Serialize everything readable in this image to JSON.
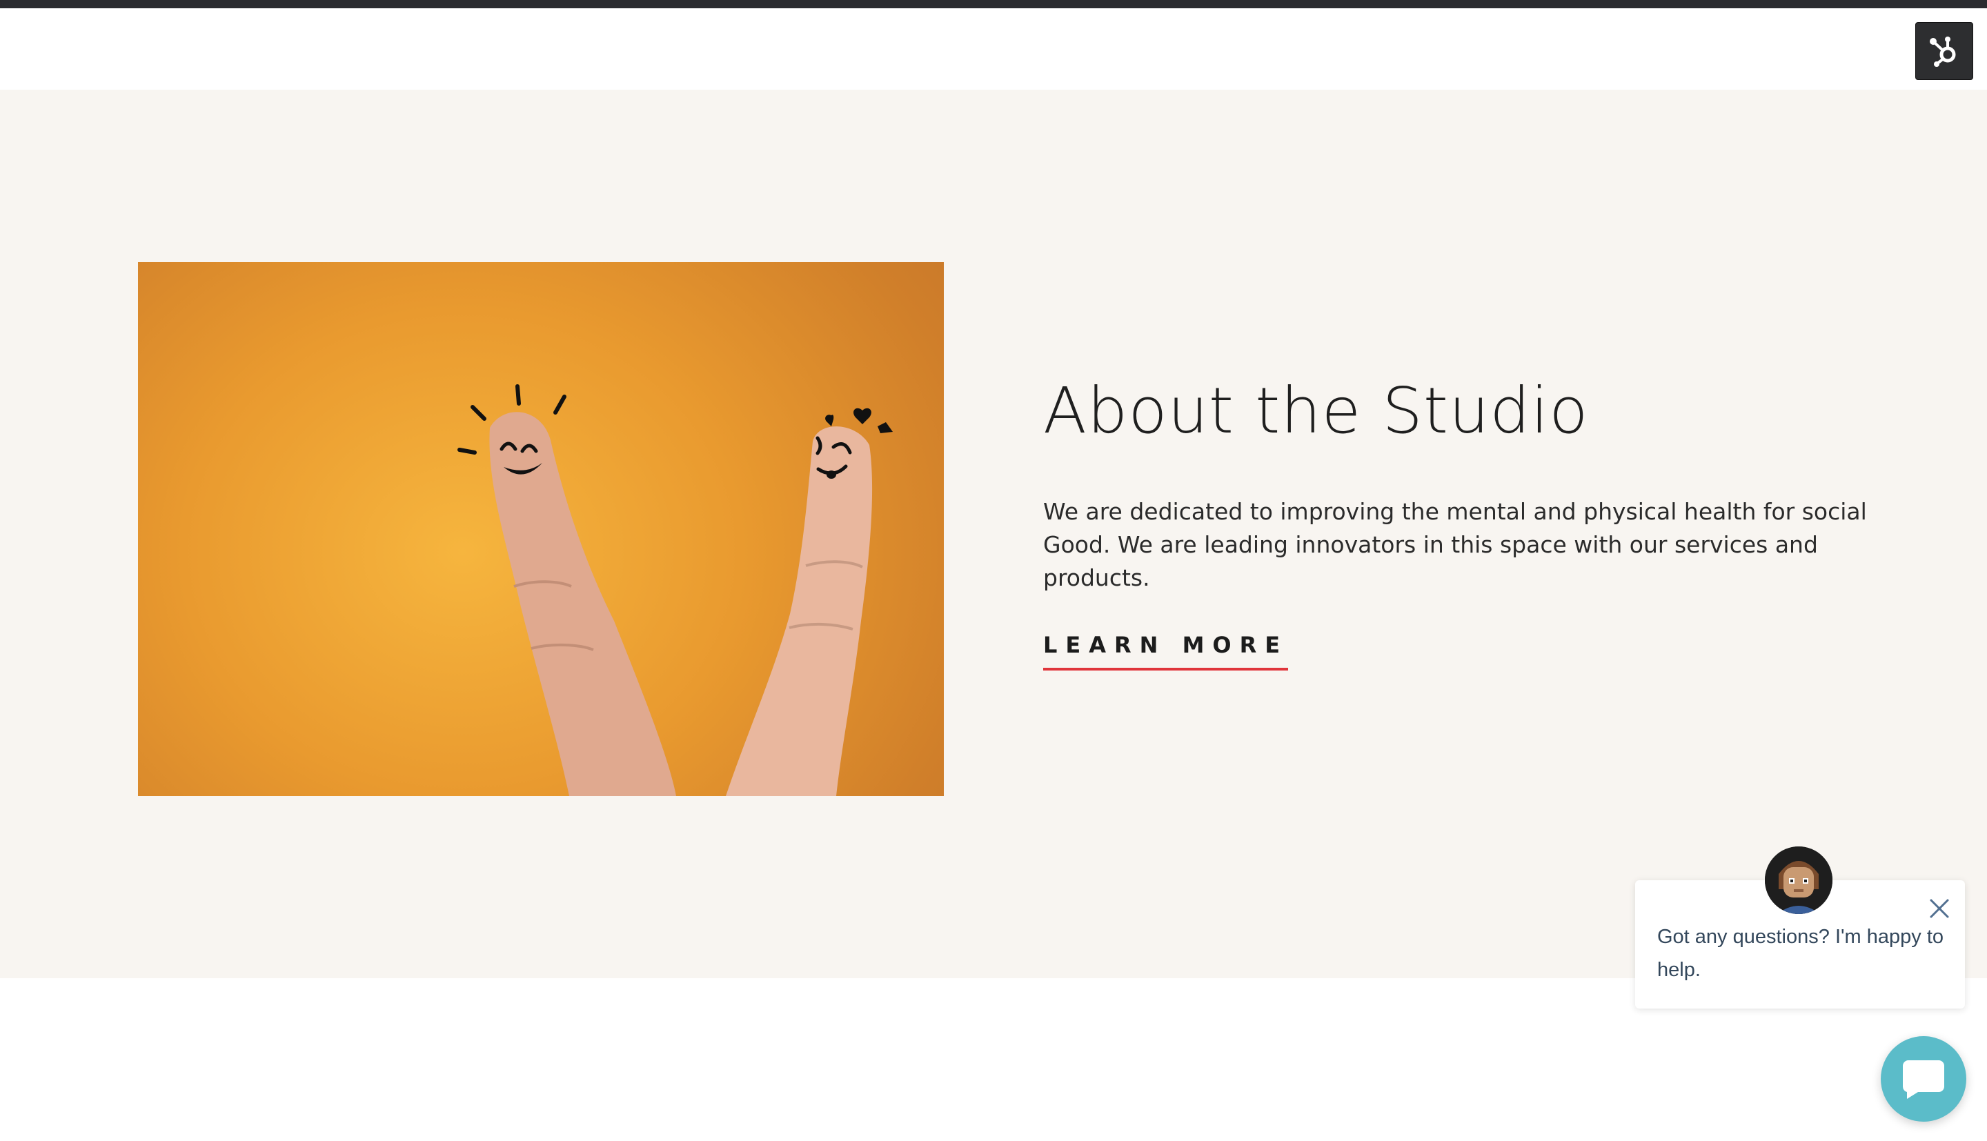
{
  "about": {
    "title": "About the Studio",
    "body": "We are dedicated to improving the mental and physical health for social Good. We are leading innovators in this space with our services and products.",
    "cta_label": "LEARN MORE"
  },
  "chat": {
    "message": "Got any questions? I'm happy to help."
  },
  "icons": {
    "badge": "hubspot-icon",
    "close": "close-icon",
    "launcher": "chat-bubble-icon"
  },
  "colors": {
    "section_background": "#f8f5f1",
    "cta_underline": "#e0353b",
    "photo_background": "#e99a2f",
    "chat_launcher": "#5bbcc9",
    "top_bar": "#2a2b2f"
  }
}
